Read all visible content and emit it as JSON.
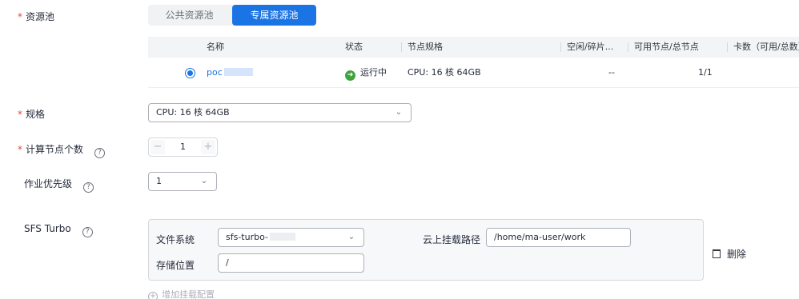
{
  "resource_pool": {
    "label": "资源池",
    "tabs": [
      {
        "label": "公共资源池",
        "active": false
      },
      {
        "label": "专属资源池",
        "active": true
      }
    ],
    "table": {
      "columns": [
        "名称",
        "状态",
        "节点规格",
        "空闲/碎片...",
        "可用节点/总节点",
        "卡数（可用/总数）"
      ],
      "rows": [
        {
          "name": "poc",
          "status": "运行中",
          "spec": "CPU: 16 核 64GB",
          "idle": "--",
          "nodes": "1/1",
          "cards": ""
        }
      ]
    }
  },
  "spec": {
    "label": "规格",
    "value": "CPU: 16 核 64GB"
  },
  "node_count": {
    "label": "计算节点个数",
    "value": "1"
  },
  "priority": {
    "label": "作业优先级",
    "value": "1"
  },
  "sfs": {
    "label": "SFS Turbo",
    "fs_label": "文件系统",
    "fs_value": "sfs-turbo-",
    "path_label": "云上挂载路径",
    "path_value": "/home/ma-user/work",
    "storage_label": "存储位置",
    "storage_value": "/",
    "delete_label": "删除",
    "add_label": "增加挂载配置"
  },
  "icons": {
    "help": "?",
    "required": "*",
    "chevron": "chevron-down-icon"
  }
}
